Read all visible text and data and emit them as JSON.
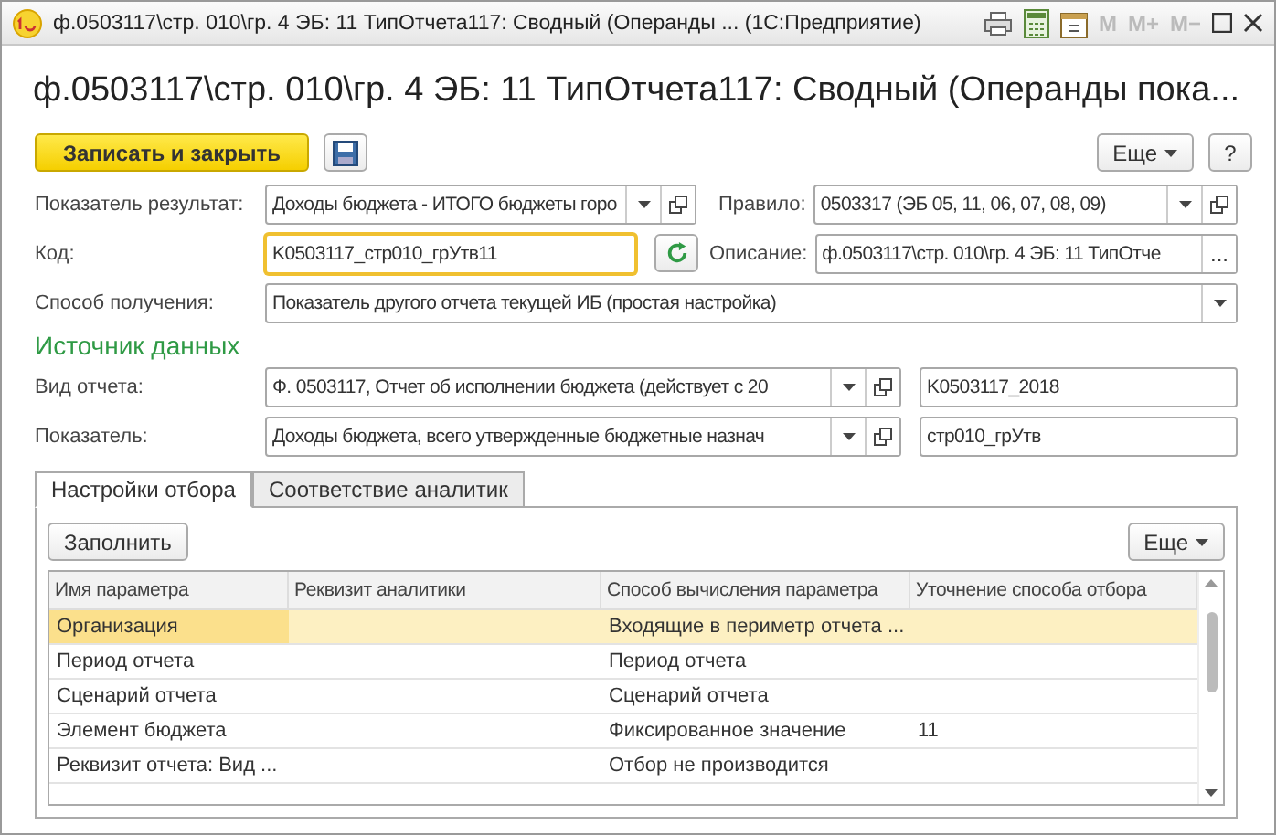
{
  "window": {
    "title": "ф.0503117\\стр. 010\\гр. 4 ЭБ: 11 ТипОтчета117: Сводный (Операнды ...  (1С:Предприятие)",
    "memory_buttons": [
      "M",
      "M+",
      "M−"
    ]
  },
  "heading": "ф.0503117\\стр. 010\\гр. 4 ЭБ: 11 ТипОтчета117: Сводный (Операнды пока...",
  "toolbar": {
    "primary": "Записать и закрыть",
    "more": "Еще",
    "help": "?"
  },
  "fields": [
    {
      "label": "Показатель результат:",
      "value": "Доходы бюджета - ИТОГО бюджеты горо",
      "kind": "select",
      "second_label": "Правило:",
      "second_value": "0503317 (ЭБ 05, 11, 06, 07, 08, 09)"
    },
    {
      "label": "Код:",
      "value": "K0503117_стр010_грУтв11",
      "kind": "code",
      "focused": true,
      "second_label": "Описание:",
      "second_value": "ф.0503117\\стр. 010\\гр. 4 ЭБ: 11 ТипОтче",
      "ellipsis": "..."
    },
    {
      "label": "Способ получения:",
      "value": "Показатель другого отчета текущей ИБ (простая настройка)",
      "kind": "wide"
    }
  ],
  "section_title": "Источник данных",
  "source_fields": [
    {
      "label": "Вид отчета:",
      "value": "Ф. 0503117, Отчет об исполнении бюджета (действует с 20",
      "extra": "K0503117_2018"
    },
    {
      "label": "Показатель:",
      "value": "Доходы бюджета, всего утвержденные бюджетные назнач",
      "extra": "стр010_грУтв"
    }
  ],
  "tabs": [
    {
      "label": "Настройки отбора",
      "selected": true
    },
    {
      "label": "Соответствие аналитик",
      "selected": false
    }
  ],
  "table_toolbar": {
    "fill": "Заполнить",
    "more": "Еще"
  },
  "table": {
    "columns": [
      "Имя параметра",
      "Реквизит аналитики",
      "Способ вычисления параметра",
      "Уточнение способа отбора"
    ],
    "rows": [
      {
        "cells": [
          "Организация",
          "",
          "Входящие в периметр отчета ...",
          ""
        ],
        "selected": true
      },
      {
        "cells": [
          "Период отчета",
          "",
          "Период отчета",
          ""
        ],
        "selected": false
      },
      {
        "cells": [
          "Сценарий отчета",
          "",
          "Сценарий отчета",
          ""
        ],
        "selected": false
      },
      {
        "cells": [
          "Элемент бюджета",
          "",
          "Фиксированное значение",
          "11"
        ],
        "selected": false
      },
      {
        "cells": [
          "Реквизит отчета: Вид ...",
          "",
          "Отбор не производится",
          ""
        ],
        "selected": false
      }
    ]
  }
}
